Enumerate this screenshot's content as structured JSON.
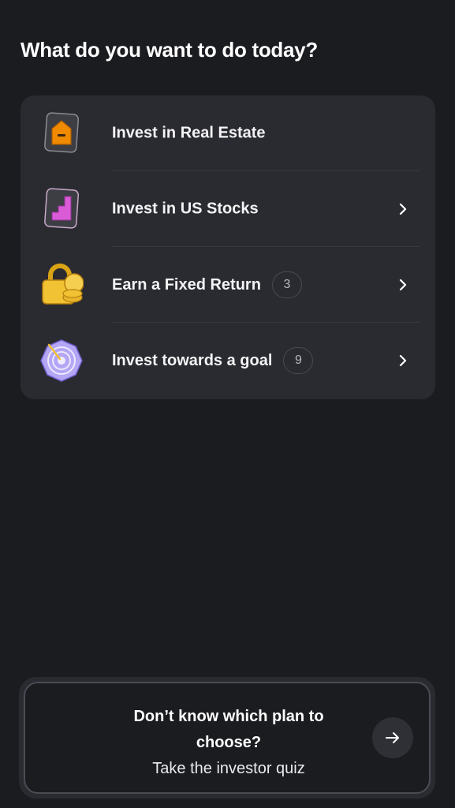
{
  "header": {
    "title": "What do you want to do today?"
  },
  "options": [
    {
      "label": "Invest in Real Estate",
      "badge": null,
      "icon": "house-icon",
      "chevron": false
    },
    {
      "label": "Invest in US Stocks",
      "badge": null,
      "icon": "stocks-chart-icon",
      "chevron": true
    },
    {
      "label": "Earn a Fixed Return",
      "badge": "3",
      "icon": "padlock-coins-icon",
      "chevron": true
    },
    {
      "label": "Invest towards a goal",
      "badge": "9",
      "icon": "target-icon",
      "chevron": true
    }
  ],
  "quiz": {
    "line1": "Don’t know which plan to choose?",
    "line2": "Take the investor quiz",
    "button_icon": "arrow-right-icon"
  },
  "colors": {
    "background": "#1b1c20",
    "card": "#2a2b30",
    "accent_orange": "#f08a00",
    "accent_pink": "#d95bd6",
    "accent_gold": "#f1c233",
    "accent_purple": "#b4a6f5"
  }
}
